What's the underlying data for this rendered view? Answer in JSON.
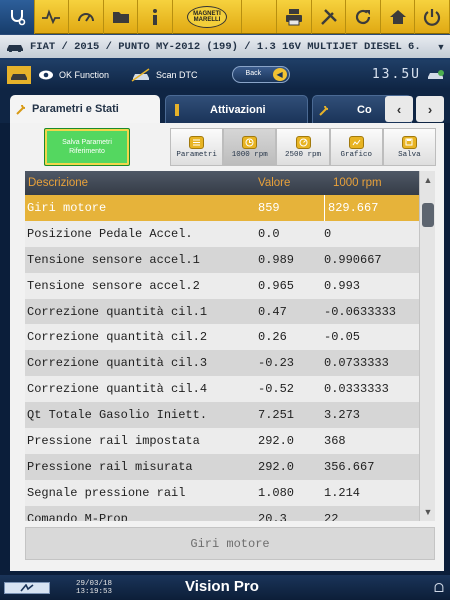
{
  "toolbar": {
    "logo_text": "MAGNETI MARELLI"
  },
  "vehicle": {
    "description": "FIAT / 2015 / PUNTO MY-2012 (199) / 1.3 16V MULTIJET DIESEL 6."
  },
  "function_bar": {
    "ok_function": "OK Function",
    "scan_dtc": "Scan DTC",
    "back": "Back",
    "voltage": "13.5U"
  },
  "tabs": [
    {
      "label": "Parametri e Stati"
    },
    {
      "label": "Attivazioni"
    },
    {
      "label": "Co"
    }
  ],
  "toolbar_actions": {
    "save_reference": "Salva Parametri Riferimento",
    "buttons": [
      "Parametri",
      "1000 rpm",
      "2500 rpm",
      "Grafico",
      "Salva"
    ]
  },
  "table": {
    "headers": {
      "description": "Descrizione",
      "value": "Valore",
      "rpm": "1000 rpm"
    },
    "rows": [
      {
        "desc": "Giri motore",
        "value": "859",
        "rpm": "829.667"
      },
      {
        "desc": "Posizione Pedale Accel.",
        "value": "0.0",
        "rpm": "0"
      },
      {
        "desc": "Tensione sensore accel.1",
        "value": "0.989",
        "rpm": "0.990667"
      },
      {
        "desc": "Tensione sensore accel.2",
        "value": "0.965",
        "rpm": "0.993"
      },
      {
        "desc": "Correzione quantità cil.1",
        "value": "0.47",
        "rpm": "-0.0633333"
      },
      {
        "desc": "Correzione quantità cil.2",
        "value": "0.26",
        "rpm": "-0.05"
      },
      {
        "desc": "Correzione quantità cil.3",
        "value": "-0.23",
        "rpm": "0.0733333"
      },
      {
        "desc": "Correzione quantità cil.4",
        "value": "-0.52",
        "rpm": "0.0333333"
      },
      {
        "desc": "Qt Totale Gasolio Iniett.",
        "value": "7.251",
        "rpm": "3.273"
      },
      {
        "desc": "Pressione rail impostata",
        "value": "292.0",
        "rpm": "368"
      },
      {
        "desc": "Pressione rail misurata",
        "value": "292.0",
        "rpm": "356.667"
      },
      {
        "desc": "Segnale pressione rail",
        "value": "1.080",
        "rpm": "1.214"
      },
      {
        "desc": "Comando M-Prop",
        "value": "20.3",
        "rpm": "22"
      }
    ]
  },
  "selected_parameter": "Giri motore",
  "status": {
    "date": "29/03/18",
    "time": "13:19:53",
    "brand": "Vision Pro"
  }
}
